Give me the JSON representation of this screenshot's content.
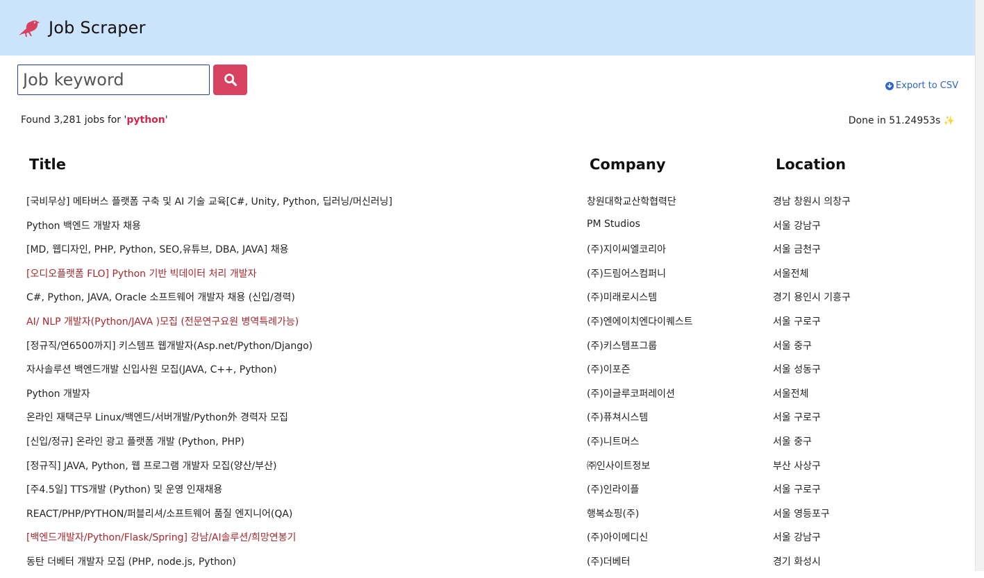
{
  "header": {
    "app_title": "Job Scraper",
    "logo_icon": "crow-icon",
    "background_color": "#cbe3fb"
  },
  "search": {
    "placeholder": "Job keyword",
    "value": "",
    "button_icon": "search-icon",
    "button_color": "#d6425f"
  },
  "export": {
    "label": "Export to CSV",
    "icon": "download-circle-icon"
  },
  "results_summary": {
    "prefix": "Found 3,281 jobs for '",
    "keyword": "python",
    "suffix": "'",
    "done": "Done in 51.24953s",
    "done_icon": "✨"
  },
  "table": {
    "headers": [
      "Title",
      "Company",
      "Location"
    ],
    "visited_link_color": "#a8272c",
    "rows": [
      {
        "title": "[국비무상] 메타버스 플랫폼 구축 및 AI 기술 교육[C#, Unity, Python, 딥러닝/머신러닝]",
        "company": "창원대학교산학협력단",
        "location": "경남 창원시 의창구",
        "visited": false
      },
      {
        "title": "Python 백엔드 개발자 채용",
        "company": "PM Studios",
        "location": "서울 강남구",
        "visited": false
      },
      {
        "title": "[MD, 웹디자인, PHP, Python, SEO,유튜브, DBA, JAVA] 채용",
        "company": "(주)지이씨엘코리아",
        "location": "서울 금천구",
        "visited": false
      },
      {
        "title": "[오디오플랫폼 FLO] Python 기반 빅데이터 처리 개발자",
        "company": "(주)드림어스컴퍼니",
        "location": "서울전체",
        "visited": true
      },
      {
        "title": "C#, Python, JAVA, Oracle 소프트웨어 개발자 채용 (신입/경력)",
        "company": "(주)미래로시스템",
        "location": "경기 용인시 기흥구",
        "visited": false
      },
      {
        "title": "AI/ NLP 개발자(Python/JAVA )모집 (전문연구요원 병역특례가능)",
        "company": "(주)엔에이치엔다이퀘스트",
        "location": "서울 구로구",
        "visited": true
      },
      {
        "title": "[정규직/연6500까지] 키스템프 웹개발자(Asp.net/Python/Django)",
        "company": "(주)키스템프그룹",
        "location": "서울 중구",
        "visited": false
      },
      {
        "title": "자사솔루션 백엔드개발 신입사원 모집(JAVA, C++, Python)",
        "company": "(주)이포즌",
        "location": "서울 성동구",
        "visited": false
      },
      {
        "title": "Python 개발자",
        "company": "(주)이글루코퍼레이션",
        "location": "서울전체",
        "visited": false
      },
      {
        "title": "온라인 재택근무 Linux/백엔드/서버개발/Python外 경력자 모집",
        "company": "(주)퓨쳐시스템",
        "location": "서울 구로구",
        "visited": false
      },
      {
        "title": "[신입/정규] 온라인 광고 플랫폼 개발 (Python, PHP)",
        "company": "(주)니트머스",
        "location": "서울 중구",
        "visited": false
      },
      {
        "title": "[정규직] JAVA, Python, 웹 프로그램 개발자 모집(양산/부산)",
        "company": "㈜인사이트정보",
        "location": "부산 사상구",
        "visited": false
      },
      {
        "title": "[주4.5일] TTS개발 (Python) 및 운영 인재채용",
        "company": "(주)인라이플",
        "location": "서울 구로구",
        "visited": false
      },
      {
        "title": "REACT/PHP/PYTHON/퍼블리셔/소프트웨어 품질 엔지니어(QA)",
        "company": "행복쇼핑(주)",
        "location": "서울 영등포구",
        "visited": false
      },
      {
        "title": "[백엔드개발자/Python/Flask/Spring] 강남/AI솔루션/희망연봉기",
        "company": "(주)아이메디신",
        "location": "서울 강남구",
        "visited": true
      },
      {
        "title": "동탄 더베터 개발자 모집 (PHP, node.js, Python)",
        "company": "(주)더베터",
        "location": "경기 화성시",
        "visited": false
      }
    ]
  }
}
